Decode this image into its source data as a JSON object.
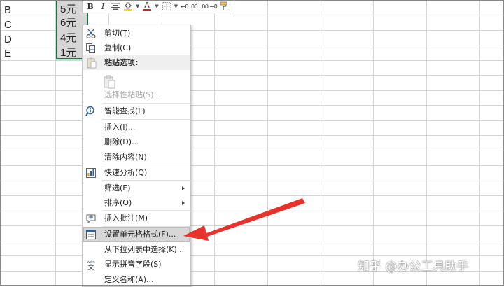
{
  "sheet": {
    "column_a": [
      "B",
      "C",
      "D",
      "E"
    ],
    "column_b": [
      "5元",
      "6元",
      "4元",
      "1元"
    ]
  },
  "mini_toolbar": {
    "bold": "B",
    "italic": "I",
    "font_color": "A",
    "icons": [
      "bold-icon",
      "italic-icon",
      "align-center-icon",
      "fill-color-icon",
      "font-color-icon",
      "borders-icon",
      "increase-decimal-icon",
      "decrease-decimal-icon",
      "format-painter-icon"
    ]
  },
  "context_menu": {
    "cut": "剪切(T)",
    "copy": "复制(C)",
    "paste_options": "粘贴选项:",
    "paste_special": "选择性粘贴(S)...",
    "smart_lookup": "智能查找(L)",
    "insert": "插入(I)...",
    "delete": "删除(D)...",
    "clear_contents": "清除内容(N)",
    "quick_analysis": "快速分析(Q)",
    "filter": "筛选(E)",
    "sort": "排序(O)",
    "insert_comment": "插入批注(M)",
    "format_cells": "设置单元格格式(F)...",
    "pick_from_list": "从下拉列表中选择(K)...",
    "show_phonetic": "显示拼音字段(S)",
    "define_name": "定义名称(A)..."
  },
  "watermark": "知乎 @办公工具助手",
  "colors": {
    "selection_border": "#217346",
    "arrow": "#e8322b",
    "menu_highlight": "#d7d7d7"
  }
}
